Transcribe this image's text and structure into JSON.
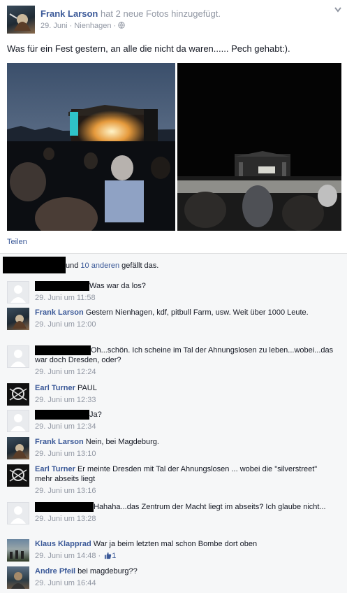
{
  "post": {
    "author": "Frank Larson",
    "action": " hat 2 neue Fotos hinzugefügt.",
    "date": "29. Juni",
    "sep": " · ",
    "location": "Nienhagen",
    "sep2": " · ",
    "text": "Was für ein Fest gestern, an alle die nicht da waren...... Pech gehabt:).",
    "share_label": "Teilen"
  },
  "likes": {
    "and": "und ",
    "others_link": "10 anderen",
    "suffix": " gefällt das."
  },
  "comments": [
    {
      "author": "",
      "text": "Was war da los?",
      "time": "29. Juni um 11:58"
    },
    {
      "author": "Frank Larson",
      "text": "Gestern Nienhagen, kdf, pitbull Farm, usw. Weit über 1000 Leute.",
      "time": "29. Juni um 12:00"
    },
    {
      "author": "",
      "text": "Oh...schön. Ich scheine im Tal der Ahnungslosen zu leben...wobei...das war doch Dresden, oder?",
      "time": "29. Juni um 12:24"
    },
    {
      "author": "Earl Turner",
      "text": "PAUL",
      "time": "29. Juni um 12:33"
    },
    {
      "author": "",
      "text": "Ja?",
      "time": "29. Juni um 12:34"
    },
    {
      "author": "Frank Larson",
      "text": "Nein, bei Magdeburg.",
      "time": "29. Juni um 13:10"
    },
    {
      "author": "Earl Turner",
      "text": "Er meinte Dresden mit Tal der Ahnungslosen ... wobei die \"silverstreet\" mehr abseits liegt",
      "time": "29. Juni um 13:16"
    },
    {
      "author": "",
      "text": "Hahaha...das Zentrum der Macht liegt im abseits? Ich glaube nicht...",
      "time": "29. Juni um 13:28"
    },
    {
      "author": "Klaus Klapprad",
      "text": "War ja beim letzten mal schon Bombe dort oben",
      "time": "29. Juni um 14:48",
      "sep": " · ",
      "like_count": "1"
    },
    {
      "author": "Andre Pfeil",
      "text": "bei magdeburg??",
      "time": "29. Juni um 16:44"
    }
  ],
  "colors": {
    "link": "#3b5998",
    "meta": "#9197a3",
    "panel": "#f6f7f8"
  },
  "icons": {
    "chevron": "chevron-down-icon",
    "globe": "globe-icon",
    "thumb": "thumbs-up-icon",
    "default_avatar": "default-profile-icon"
  }
}
